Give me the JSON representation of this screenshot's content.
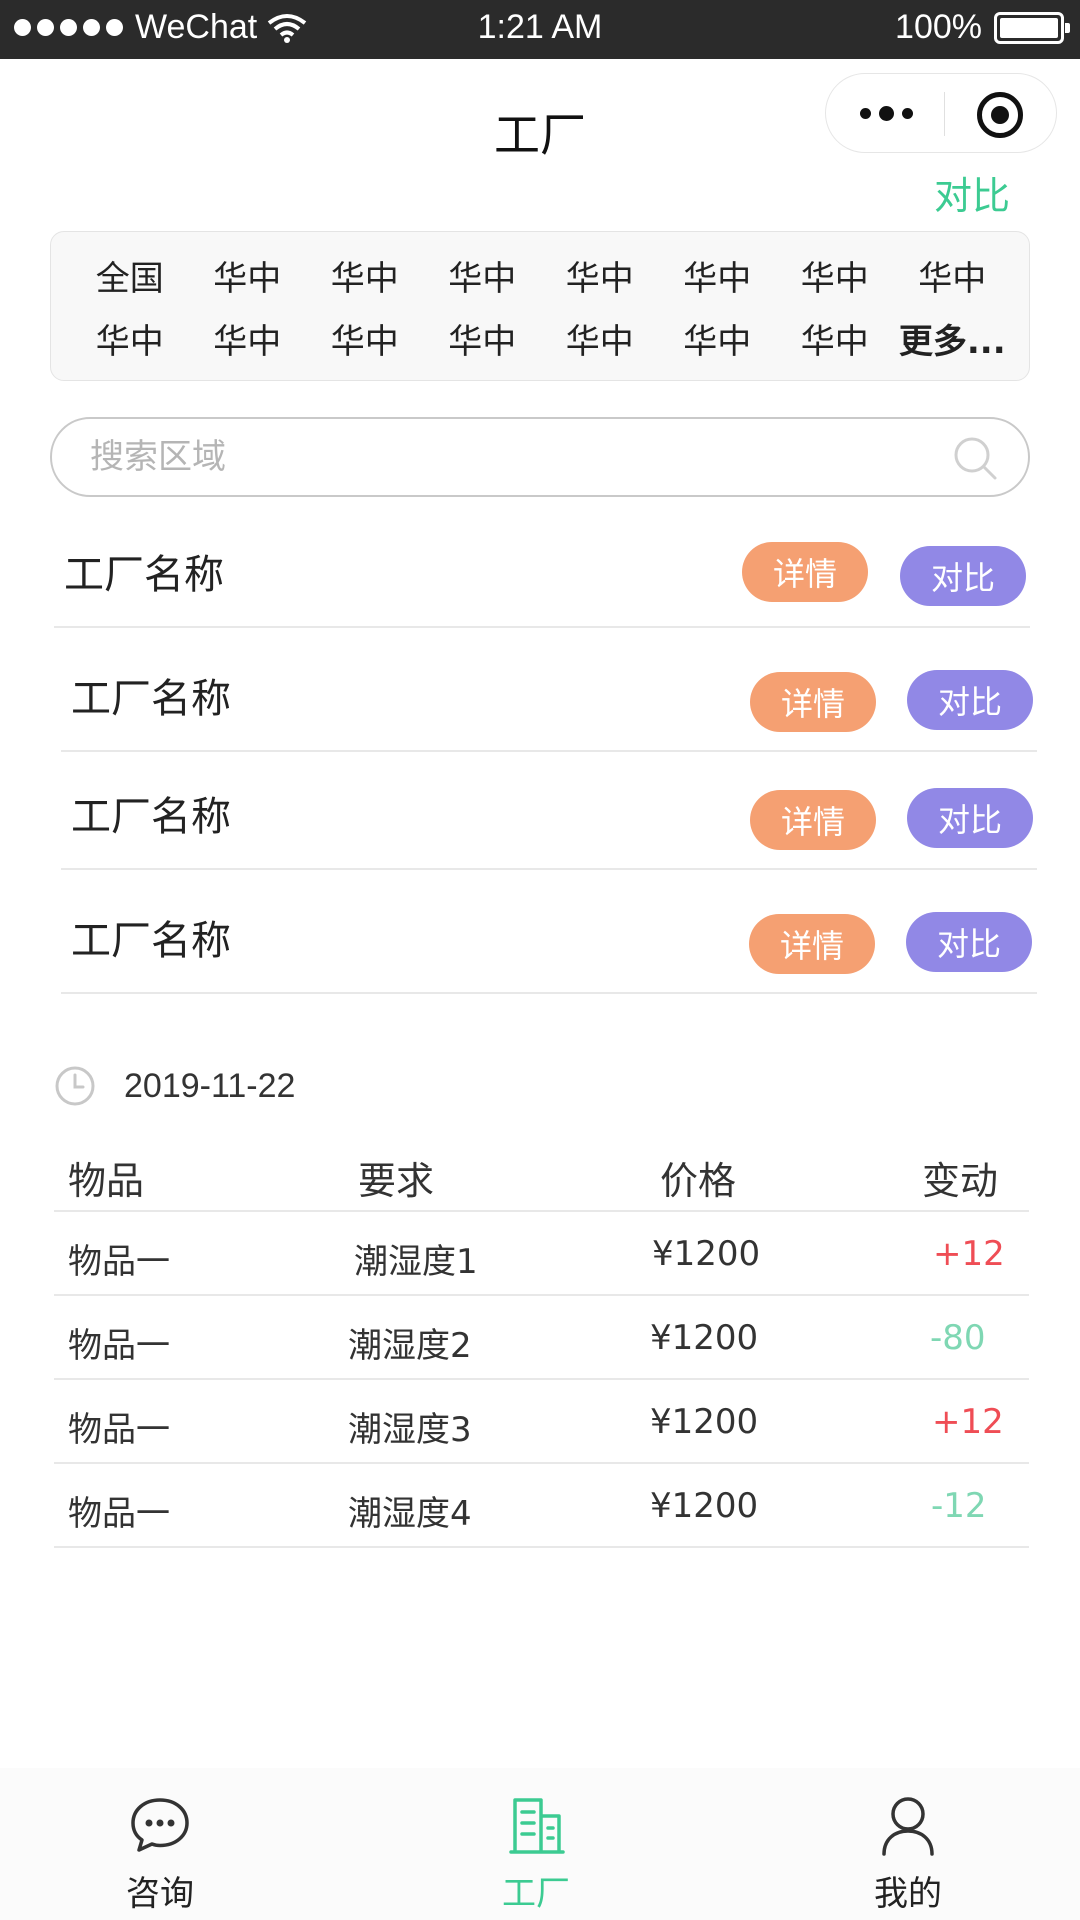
{
  "status_bar": {
    "carrier": "WeChat",
    "time": "1:21 AM",
    "battery": "100%"
  },
  "nav": {
    "title": "工厂",
    "compare_link": "对比"
  },
  "regions": [
    "全国",
    "华中",
    "华中",
    "华中",
    "华中",
    "华中",
    "华中",
    "华中",
    "华中",
    "华中",
    "华中",
    "华中",
    "华中",
    "华中",
    "华中",
    "更多..."
  ],
  "search": {
    "placeholder": "搜索区域"
  },
  "factories": [
    {
      "name": "工厂名称",
      "detail_label": "详情",
      "compare_label": "对比"
    },
    {
      "name": "工厂名称",
      "detail_label": "详情",
      "compare_label": "对比"
    },
    {
      "name": "工厂名称",
      "detail_label": "详情",
      "compare_label": "对比"
    },
    {
      "name": "工厂名称",
      "detail_label": "详情",
      "compare_label": "对比"
    }
  ],
  "date": "2019-11-22",
  "table": {
    "headers": [
      "物品",
      "要求",
      "价格",
      "变动"
    ],
    "rows": [
      {
        "item": "物品一",
        "requirement": "潮湿度1",
        "price": "¥1200",
        "change": "+12"
      },
      {
        "item": "物品一",
        "requirement": "潮湿度2",
        "price": "¥1200",
        "change": "-80"
      },
      {
        "item": "物品一",
        "requirement": "潮湿度3",
        "price": "¥1200",
        "change": "+12"
      },
      {
        "item": "物品一",
        "requirement": "潮湿度4",
        "price": "¥1200",
        "change": "-12"
      }
    ]
  },
  "tabs": [
    {
      "label": "咨询",
      "icon": "chat-bubble-icon"
    },
    {
      "label": "工厂",
      "icon": "building-icon",
      "active": true
    },
    {
      "label": "我的",
      "icon": "person-icon"
    }
  ],
  "colors": {
    "accent_green": "#3ccb92",
    "detail_orange": "#f5a072",
    "compare_purple": "#9188e6",
    "change_positive": "#ef4d55",
    "change_negative": "#7fd7b3"
  }
}
